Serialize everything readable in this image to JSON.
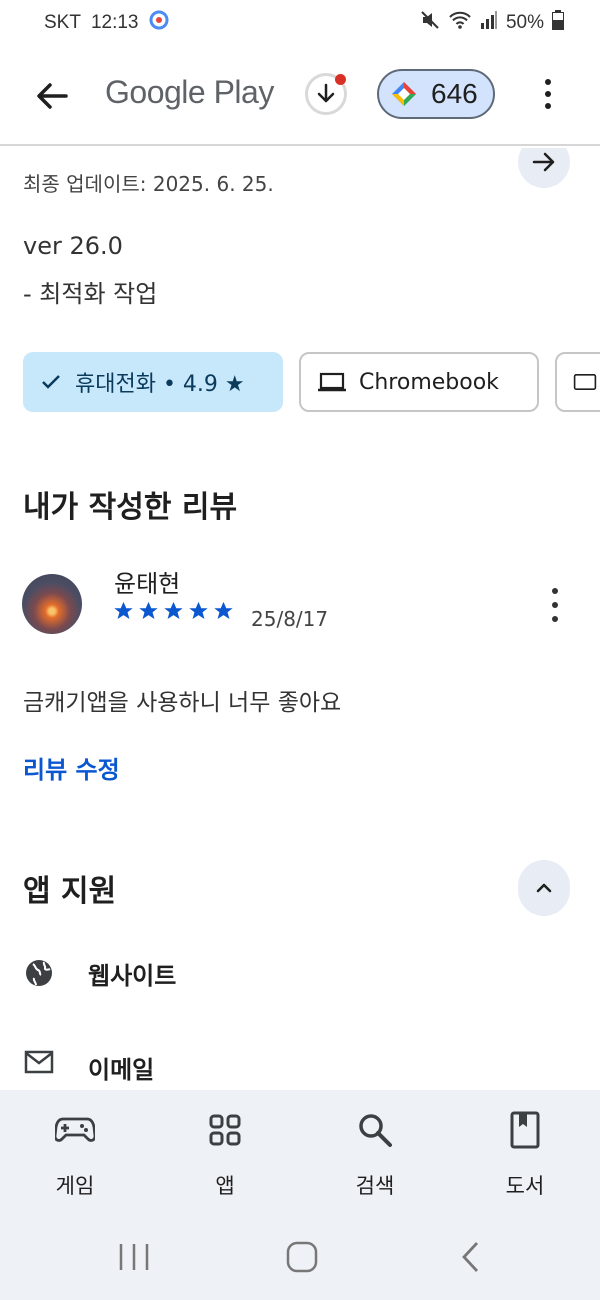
{
  "status_bar": {
    "carrier": "SKT",
    "time": "12:13",
    "battery": "50%"
  },
  "app_bar": {
    "title": "Google Play",
    "points": "646"
  },
  "update": {
    "last_updated": "최종 업데이트: 2025. 6. 25.",
    "version": "ver 26.0",
    "notes": "- 최적화 작업"
  },
  "device_chips": [
    {
      "label": "휴대전화 • 4.9 ★",
      "selected": true,
      "icon": "check-icon"
    },
    {
      "label": "Chromebook",
      "selected": false,
      "icon": "laptop-icon"
    },
    {
      "label": "",
      "selected": false,
      "icon": "tablet-icon"
    }
  ],
  "my_review": {
    "section_title": "내가 작성한 리뷰",
    "reviewer": "윤태현",
    "rating": 5,
    "date": "25/8/17",
    "text": "금캐기앱을 사용하니 너무 좋아요",
    "edit_label": "리뷰 수정"
  },
  "app_support": {
    "section_title": "앱 지원",
    "items": [
      {
        "label": "웹사이트",
        "icon": "globe-icon"
      },
      {
        "label": "이메일",
        "icon": "mail-icon"
      }
    ]
  },
  "bottom_nav": [
    {
      "label": "게임",
      "icon": "gamepad-icon"
    },
    {
      "label": "앱",
      "icon": "apps-grid-icon"
    },
    {
      "label": "검색",
      "icon": "search-icon"
    },
    {
      "label": "도서",
      "icon": "book-icon"
    }
  ],
  "colors": {
    "accent_blue": "#0b57d0",
    "chip_selected_bg": "#c7e7fb",
    "nav_bg": "#eef1f6"
  }
}
